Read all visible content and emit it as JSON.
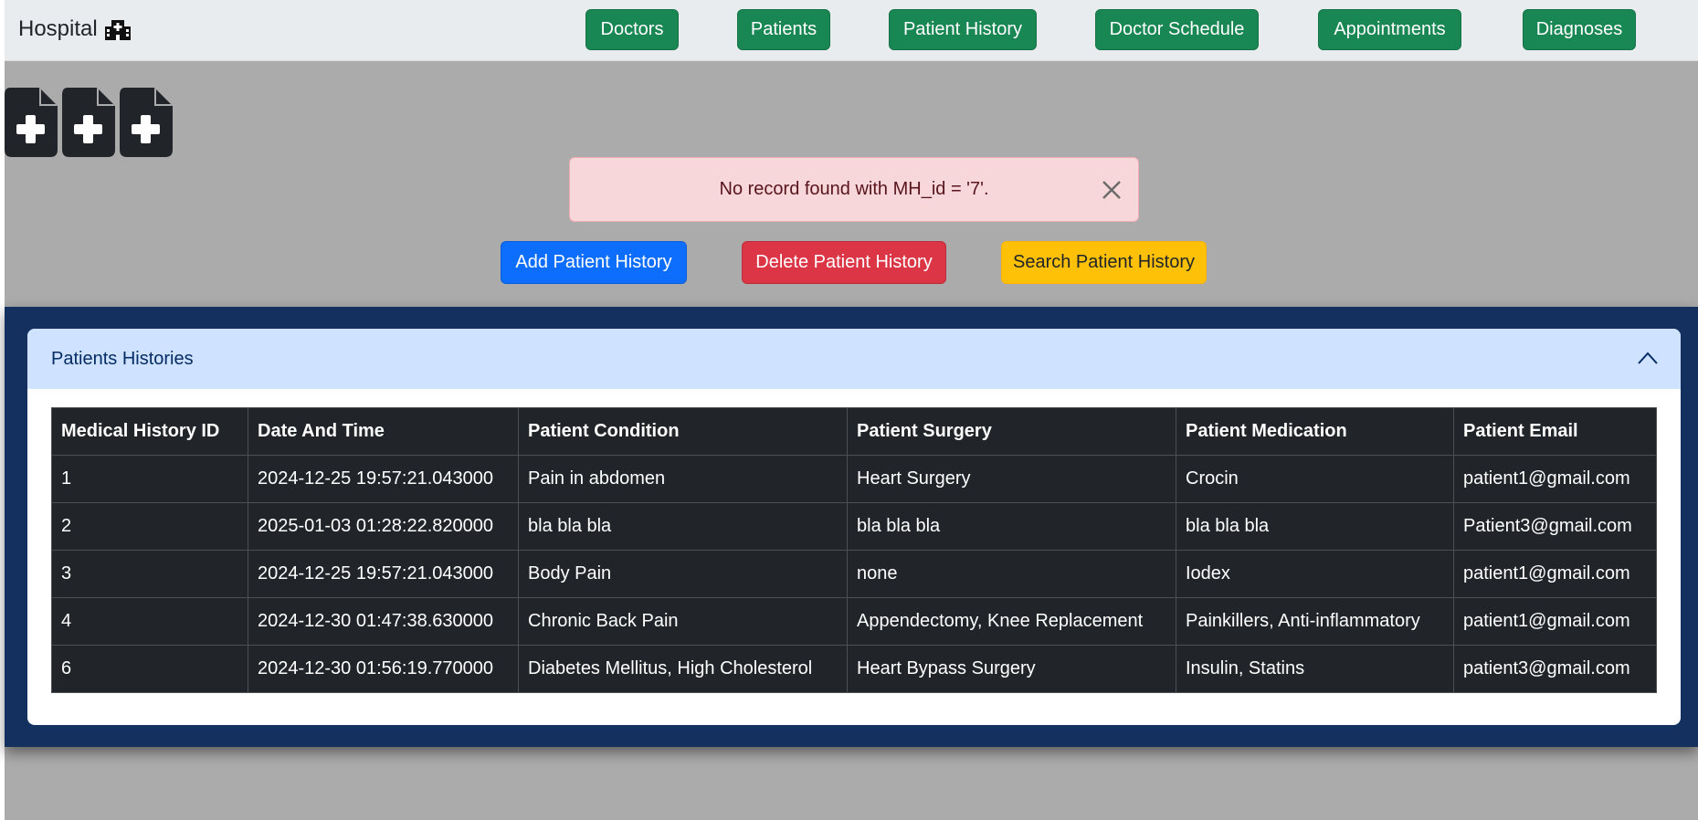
{
  "navbar": {
    "brand": "Hospital",
    "links": [
      "Doctors",
      "Patients",
      "Patient History",
      "Doctor Schedule",
      "Appointments",
      "Diagnoses"
    ]
  },
  "alert": {
    "message": "No record found with MH_id = '7'."
  },
  "actions": {
    "add": "Add Patient History",
    "delete": "Delete Patient History",
    "search": "Search Patient History"
  },
  "accordion": {
    "title": "Patients Histories"
  },
  "table": {
    "headers": [
      "Medical History ID",
      "Date And Time",
      "Patient Condition",
      "Patient Surgery",
      "Patient Medication",
      "Patient Email"
    ],
    "rows": [
      [
        "1",
        "2024-12-25 19:57:21.043000",
        "Pain in abdomen",
        "Heart Surgery",
        "Crocin",
        "patient1@gmail.com"
      ],
      [
        "2",
        "2025-01-03 01:28:22.820000",
        "bla bla bla",
        "bla bla bla",
        "bla bla bla",
        "Patient3@gmail.com"
      ],
      [
        "3",
        "2024-12-25 19:57:21.043000",
        "Body Pain",
        "none",
        "Iodex",
        "patient1@gmail.com"
      ],
      [
        "4",
        "2024-12-30 01:47:38.630000",
        "Chronic Back Pain",
        "Appendectomy, Knee Replacement",
        "Painkillers, Anti-inflammatory",
        "patient1@gmail.com"
      ],
      [
        "6",
        "2024-12-30 01:56:19.770000",
        "Diabetes Mellitus, High Cholesterol",
        "Heart Bypass Surgery",
        "Insulin, Statins",
        "patient3@gmail.com"
      ]
    ]
  },
  "colors": {
    "nav_button": "#198754",
    "primary": "#0d6efd",
    "danger": "#dc3545",
    "warning": "#ffc107",
    "panel": "#14305e",
    "table_dark": "#212529"
  }
}
